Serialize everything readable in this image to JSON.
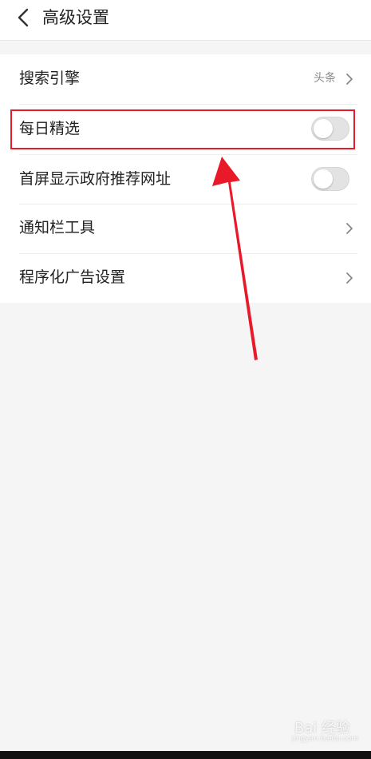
{
  "header": {
    "title": "高级设置",
    "back_icon": "chevron-left-icon"
  },
  "settings": [
    {
      "label": "搜索引擎",
      "value": "头条",
      "control": "chevron-right-icon"
    },
    {
      "label": "每日精选",
      "control": "toggle",
      "on": false
    },
    {
      "label": "首屏显示政府推荐网址",
      "control": "toggle",
      "on": false
    },
    {
      "label": "通知栏工具",
      "control": "chevron-right-icon"
    },
    {
      "label": "程序化广告设置",
      "control": "chevron-right-icon"
    }
  ],
  "annotation": {
    "highlight_color": "#e81a2a",
    "arrow_color": "#e81a2a",
    "highlighted_item": "每日精选"
  },
  "colors": {
    "background": "#f5f5f5",
    "panel": "#ffffff",
    "text": "#222222",
    "secondary_text": "#888888"
  },
  "watermark": {
    "text": "Bai 经验",
    "sub": "jingyan.baidu.com"
  }
}
